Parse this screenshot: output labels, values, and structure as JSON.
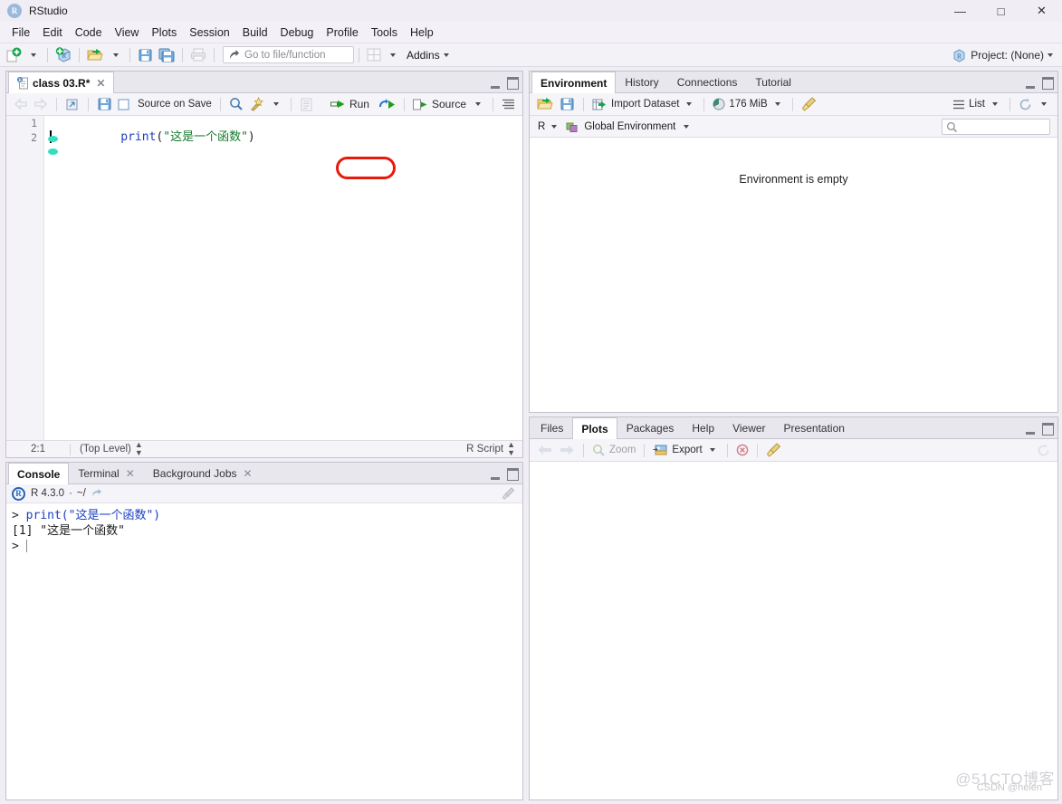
{
  "window": {
    "app_name": "RStudio",
    "app_icon": "R",
    "minimize": "—",
    "maximize": "□",
    "close": "✕"
  },
  "menubar": {
    "items": [
      {
        "label": "File"
      },
      {
        "label": "Edit"
      },
      {
        "label": "Code"
      },
      {
        "label": "View"
      },
      {
        "label": "Plots"
      },
      {
        "label": "Session"
      },
      {
        "label": "Build"
      },
      {
        "label": "Debug"
      },
      {
        "label": "Profile"
      },
      {
        "label": "Tools"
      },
      {
        "label": "Help"
      }
    ]
  },
  "toolbar": {
    "new_file_icon": "new-file-icon",
    "new_project_icon": "new-project-icon",
    "open_file_icon": "open-folder-icon",
    "save_icon": "save-icon",
    "save_all_icon": "save-all-icon",
    "print_icon": "print-icon",
    "goto_placeholder": "Go to file/function",
    "panes_icon": "pane-layout-icon",
    "addins_label": "Addins",
    "project_label": "Project: (None)",
    "project_icon": "r-project-icon"
  },
  "source_pane": {
    "tabs": [
      {
        "label": "class 03.R*",
        "closable": true,
        "active": true
      }
    ],
    "tools": {
      "back_icon": "back-arrow-icon",
      "forward_icon": "forward-arrow-icon",
      "popout_icon": "show-in-new-window-icon",
      "save_icon": "save-icon",
      "source_on_save_label": "Source on Save",
      "find_icon": "search-icon",
      "magic_icon": "code-tools-icon",
      "outline_icon": "document-outline-icon",
      "run_label": "Run",
      "rerun_icon": "rerun-icon",
      "source_label": "Source",
      "show_outline_icon": "show-outline-icon"
    },
    "editor": {
      "line_numbers": [
        "1",
        "2"
      ],
      "lines": [
        {
          "parts": [
            {
              "text": "print",
              "cls": "tok-fn"
            },
            {
              "text": "(",
              "cls": "tok-p"
            },
            {
              "text": "\"这是一个函数\"",
              "cls": "tok-str"
            },
            {
              "text": ")",
              "cls": "tok-p"
            }
          ]
        },
        {
          "parts": []
        }
      ]
    },
    "status": {
      "cursor_position": "2:1",
      "scope": "(Top Level)",
      "file_type": "R Script"
    }
  },
  "console_pane": {
    "tabs": [
      {
        "label": "Console",
        "closable": false,
        "active": true
      },
      {
        "label": "Terminal",
        "closable": true,
        "active": false
      },
      {
        "label": "Background Jobs",
        "closable": true,
        "active": false
      }
    ],
    "header": {
      "r_badge": "R",
      "version": "R 4.3.0",
      "separator": "·",
      "working_dir": "~/",
      "popout_icon": "show-in-new-window-icon",
      "clear_icon": "broom-clear-icon"
    },
    "output": [
      {
        "type": "input",
        "prompt": "> ",
        "text": "print(\"这是一个函数\")"
      },
      {
        "type": "result",
        "prompt": "",
        "text": "[1] \"这是一个函数\""
      },
      {
        "type": "prompt",
        "prompt": "> ",
        "text": ""
      }
    ]
  },
  "env_pane": {
    "tabs": [
      {
        "label": "Environment",
        "active": true
      },
      {
        "label": "History",
        "active": false
      },
      {
        "label": "Connections",
        "active": false
      },
      {
        "label": "Tutorial",
        "active": false
      }
    ],
    "tools": {
      "load_icon": "open-folder-icon",
      "save_icon": "save-icon",
      "import_dataset_label": "Import Dataset",
      "memory_label": "176 MiB",
      "memory_icon": "memory-pie-icon",
      "clear_icon": "broom-clear-icon",
      "list_label": "List",
      "list_icon": "list-view-icon",
      "refresh_icon": "refresh-icon"
    },
    "scope": {
      "language": "R",
      "environment_label": "Global Environment",
      "environment_icon": "global-env-icon",
      "search_placeholder": ""
    },
    "empty_message": "Environment is empty"
  },
  "files_pane": {
    "tabs": [
      {
        "label": "Files",
        "active": false
      },
      {
        "label": "Plots",
        "active": true
      },
      {
        "label": "Packages",
        "active": false
      },
      {
        "label": "Help",
        "active": false
      },
      {
        "label": "Viewer",
        "active": false
      },
      {
        "label": "Presentation",
        "active": false
      }
    ],
    "tools": {
      "back_icon": "back-arrow-icon",
      "forward_icon": "forward-arrow-icon",
      "zoom_label": "Zoom",
      "zoom_icon": "magnifier-icon",
      "export_label": "Export",
      "export_icon": "export-image-icon",
      "remove_icon": "remove-plot-icon",
      "clear_all_icon": "broom-clear-icon",
      "refresh_icon": "refresh-icon"
    }
  },
  "annotations": {
    "run_highlight_color": "#e81a0c"
  },
  "watermarks": {
    "primary": "@51CTO博客",
    "secondary": "CSDN @helen"
  },
  "colors": {
    "accent_blue": "#2065b8",
    "string_green": "#157b2c",
    "function_blue": "#1a3fc4",
    "chrome_bg": "#f0eef4",
    "pane_border": "#c5c2cc",
    "highlight_red": "#e81a0c"
  }
}
